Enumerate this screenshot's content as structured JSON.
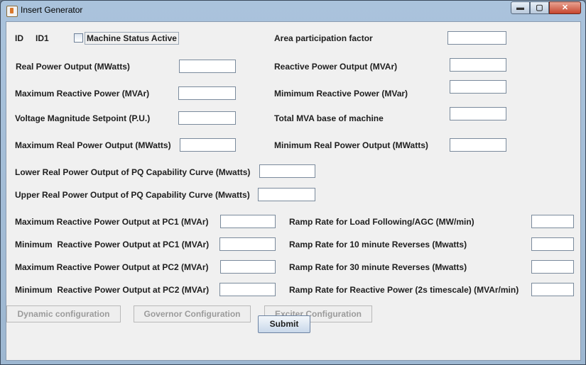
{
  "window": {
    "title": "Insert Generator",
    "controls": {
      "minimize": "▬",
      "maximize": "▢",
      "close": "✕"
    }
  },
  "header": {
    "id_label": "ID",
    "id_value": "ID1",
    "machine_status_label": "Machine Status Active",
    "machine_status_checked": false
  },
  "fields": {
    "area_participation": {
      "label": "Area participation factor",
      "value": ""
    },
    "real_power_output": {
      "label": "Real Power Output (MWatts)",
      "value": ""
    },
    "reactive_power_output": {
      "label": "Reactive Power Output (MVAr)",
      "value": ""
    },
    "max_reactive_power": {
      "label": "Maximum Reactive Power (MVAr)",
      "value": ""
    },
    "min_reactive_power": {
      "label": "Mimimum Reactive Power (MVar)",
      "value": ""
    },
    "voltage_setpoint": {
      "label": "Voltage Magnitude Setpoint (P.U.)",
      "value": ""
    },
    "total_mva_base": {
      "label": "Total MVA base of machine",
      "value": ""
    },
    "max_real_power": {
      "label": "Maximum Real Power Output (MWatts)",
      "value": ""
    },
    "min_real_power": {
      "label": "Minimum Real Power Output (MWatts)",
      "value": ""
    },
    "lower_pq_curve": {
      "label": "Lower Real Power Output of PQ Capability Curve (Mwatts)",
      "value": ""
    },
    "upper_pq_curve": {
      "label": "Upper Real Power Output of PQ Capability Curve (Mwatts)",
      "value": ""
    },
    "max_reactive_pc1": {
      "label": "Maximum Reactive Power Output at PC1 (MVAr)",
      "value": ""
    },
    "min_reactive_pc1": {
      "label": "Minimum  Reactive Power Output at PC1 (MVAr)",
      "value": ""
    },
    "max_reactive_pc2": {
      "label": "Maximum Reactive Power Output at PC2 (MVAr)",
      "value": ""
    },
    "min_reactive_pc2": {
      "label": "Minimum  Reactive Power Output at PC2 (MVAr)",
      "value": ""
    },
    "ramp_load_following": {
      "label": "Ramp Rate for Load Following/AGC (MW/min)",
      "value": ""
    },
    "ramp_10min": {
      "label": "Ramp Rate for 10 minute Reverses (Mwatts)",
      "value": ""
    },
    "ramp_30min": {
      "label": "Ramp Rate for 30 minute Reverses (Mwatts)",
      "value": ""
    },
    "ramp_reactive": {
      "label": "Ramp Rate for Reactive Power (2s timescale) (MVAr/min)",
      "value": ""
    }
  },
  "buttons": {
    "dynamic": "Dynamic configuration",
    "governor": "Governor Configuration",
    "exciter": "Exciter Configuration",
    "submit": "Submit"
  }
}
